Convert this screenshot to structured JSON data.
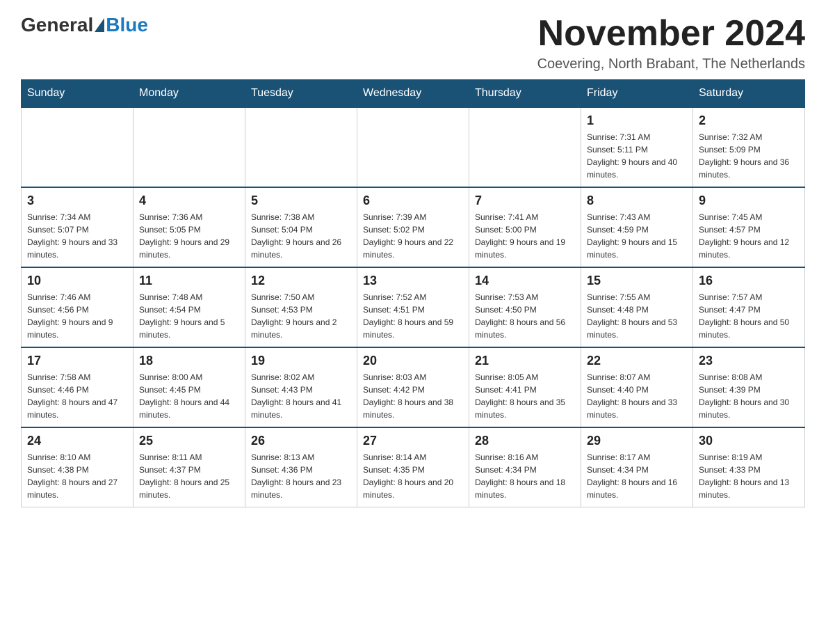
{
  "header": {
    "logo_general": "General",
    "logo_blue": "Blue",
    "month_year": "November 2024",
    "location": "Coevering, North Brabant, The Netherlands"
  },
  "days_of_week": [
    "Sunday",
    "Monday",
    "Tuesday",
    "Wednesday",
    "Thursday",
    "Friday",
    "Saturday"
  ],
  "weeks": [
    [
      {
        "day": "",
        "sunrise": "",
        "sunset": "",
        "daylight": ""
      },
      {
        "day": "",
        "sunrise": "",
        "sunset": "",
        "daylight": ""
      },
      {
        "day": "",
        "sunrise": "",
        "sunset": "",
        "daylight": ""
      },
      {
        "day": "",
        "sunrise": "",
        "sunset": "",
        "daylight": ""
      },
      {
        "day": "",
        "sunrise": "",
        "sunset": "",
        "daylight": ""
      },
      {
        "day": "1",
        "sunrise": "Sunrise: 7:31 AM",
        "sunset": "Sunset: 5:11 PM",
        "daylight": "Daylight: 9 hours and 40 minutes."
      },
      {
        "day": "2",
        "sunrise": "Sunrise: 7:32 AM",
        "sunset": "Sunset: 5:09 PM",
        "daylight": "Daylight: 9 hours and 36 minutes."
      }
    ],
    [
      {
        "day": "3",
        "sunrise": "Sunrise: 7:34 AM",
        "sunset": "Sunset: 5:07 PM",
        "daylight": "Daylight: 9 hours and 33 minutes."
      },
      {
        "day": "4",
        "sunrise": "Sunrise: 7:36 AM",
        "sunset": "Sunset: 5:05 PM",
        "daylight": "Daylight: 9 hours and 29 minutes."
      },
      {
        "day": "5",
        "sunrise": "Sunrise: 7:38 AM",
        "sunset": "Sunset: 5:04 PM",
        "daylight": "Daylight: 9 hours and 26 minutes."
      },
      {
        "day": "6",
        "sunrise": "Sunrise: 7:39 AM",
        "sunset": "Sunset: 5:02 PM",
        "daylight": "Daylight: 9 hours and 22 minutes."
      },
      {
        "day": "7",
        "sunrise": "Sunrise: 7:41 AM",
        "sunset": "Sunset: 5:00 PM",
        "daylight": "Daylight: 9 hours and 19 minutes."
      },
      {
        "day": "8",
        "sunrise": "Sunrise: 7:43 AM",
        "sunset": "Sunset: 4:59 PM",
        "daylight": "Daylight: 9 hours and 15 minutes."
      },
      {
        "day": "9",
        "sunrise": "Sunrise: 7:45 AM",
        "sunset": "Sunset: 4:57 PM",
        "daylight": "Daylight: 9 hours and 12 minutes."
      }
    ],
    [
      {
        "day": "10",
        "sunrise": "Sunrise: 7:46 AM",
        "sunset": "Sunset: 4:56 PM",
        "daylight": "Daylight: 9 hours and 9 minutes."
      },
      {
        "day": "11",
        "sunrise": "Sunrise: 7:48 AM",
        "sunset": "Sunset: 4:54 PM",
        "daylight": "Daylight: 9 hours and 5 minutes."
      },
      {
        "day": "12",
        "sunrise": "Sunrise: 7:50 AM",
        "sunset": "Sunset: 4:53 PM",
        "daylight": "Daylight: 9 hours and 2 minutes."
      },
      {
        "day": "13",
        "sunrise": "Sunrise: 7:52 AM",
        "sunset": "Sunset: 4:51 PM",
        "daylight": "Daylight: 8 hours and 59 minutes."
      },
      {
        "day": "14",
        "sunrise": "Sunrise: 7:53 AM",
        "sunset": "Sunset: 4:50 PM",
        "daylight": "Daylight: 8 hours and 56 minutes."
      },
      {
        "day": "15",
        "sunrise": "Sunrise: 7:55 AM",
        "sunset": "Sunset: 4:48 PM",
        "daylight": "Daylight: 8 hours and 53 minutes."
      },
      {
        "day": "16",
        "sunrise": "Sunrise: 7:57 AM",
        "sunset": "Sunset: 4:47 PM",
        "daylight": "Daylight: 8 hours and 50 minutes."
      }
    ],
    [
      {
        "day": "17",
        "sunrise": "Sunrise: 7:58 AM",
        "sunset": "Sunset: 4:46 PM",
        "daylight": "Daylight: 8 hours and 47 minutes."
      },
      {
        "day": "18",
        "sunrise": "Sunrise: 8:00 AM",
        "sunset": "Sunset: 4:45 PM",
        "daylight": "Daylight: 8 hours and 44 minutes."
      },
      {
        "day": "19",
        "sunrise": "Sunrise: 8:02 AM",
        "sunset": "Sunset: 4:43 PM",
        "daylight": "Daylight: 8 hours and 41 minutes."
      },
      {
        "day": "20",
        "sunrise": "Sunrise: 8:03 AM",
        "sunset": "Sunset: 4:42 PM",
        "daylight": "Daylight: 8 hours and 38 minutes."
      },
      {
        "day": "21",
        "sunrise": "Sunrise: 8:05 AM",
        "sunset": "Sunset: 4:41 PM",
        "daylight": "Daylight: 8 hours and 35 minutes."
      },
      {
        "day": "22",
        "sunrise": "Sunrise: 8:07 AM",
        "sunset": "Sunset: 4:40 PM",
        "daylight": "Daylight: 8 hours and 33 minutes."
      },
      {
        "day": "23",
        "sunrise": "Sunrise: 8:08 AM",
        "sunset": "Sunset: 4:39 PM",
        "daylight": "Daylight: 8 hours and 30 minutes."
      }
    ],
    [
      {
        "day": "24",
        "sunrise": "Sunrise: 8:10 AM",
        "sunset": "Sunset: 4:38 PM",
        "daylight": "Daylight: 8 hours and 27 minutes."
      },
      {
        "day": "25",
        "sunrise": "Sunrise: 8:11 AM",
        "sunset": "Sunset: 4:37 PM",
        "daylight": "Daylight: 8 hours and 25 minutes."
      },
      {
        "day": "26",
        "sunrise": "Sunrise: 8:13 AM",
        "sunset": "Sunset: 4:36 PM",
        "daylight": "Daylight: 8 hours and 23 minutes."
      },
      {
        "day": "27",
        "sunrise": "Sunrise: 8:14 AM",
        "sunset": "Sunset: 4:35 PM",
        "daylight": "Daylight: 8 hours and 20 minutes."
      },
      {
        "day": "28",
        "sunrise": "Sunrise: 8:16 AM",
        "sunset": "Sunset: 4:34 PM",
        "daylight": "Daylight: 8 hours and 18 minutes."
      },
      {
        "day": "29",
        "sunrise": "Sunrise: 8:17 AM",
        "sunset": "Sunset: 4:34 PM",
        "daylight": "Daylight: 8 hours and 16 minutes."
      },
      {
        "day": "30",
        "sunrise": "Sunrise: 8:19 AM",
        "sunset": "Sunset: 4:33 PM",
        "daylight": "Daylight: 8 hours and 13 minutes."
      }
    ]
  ]
}
